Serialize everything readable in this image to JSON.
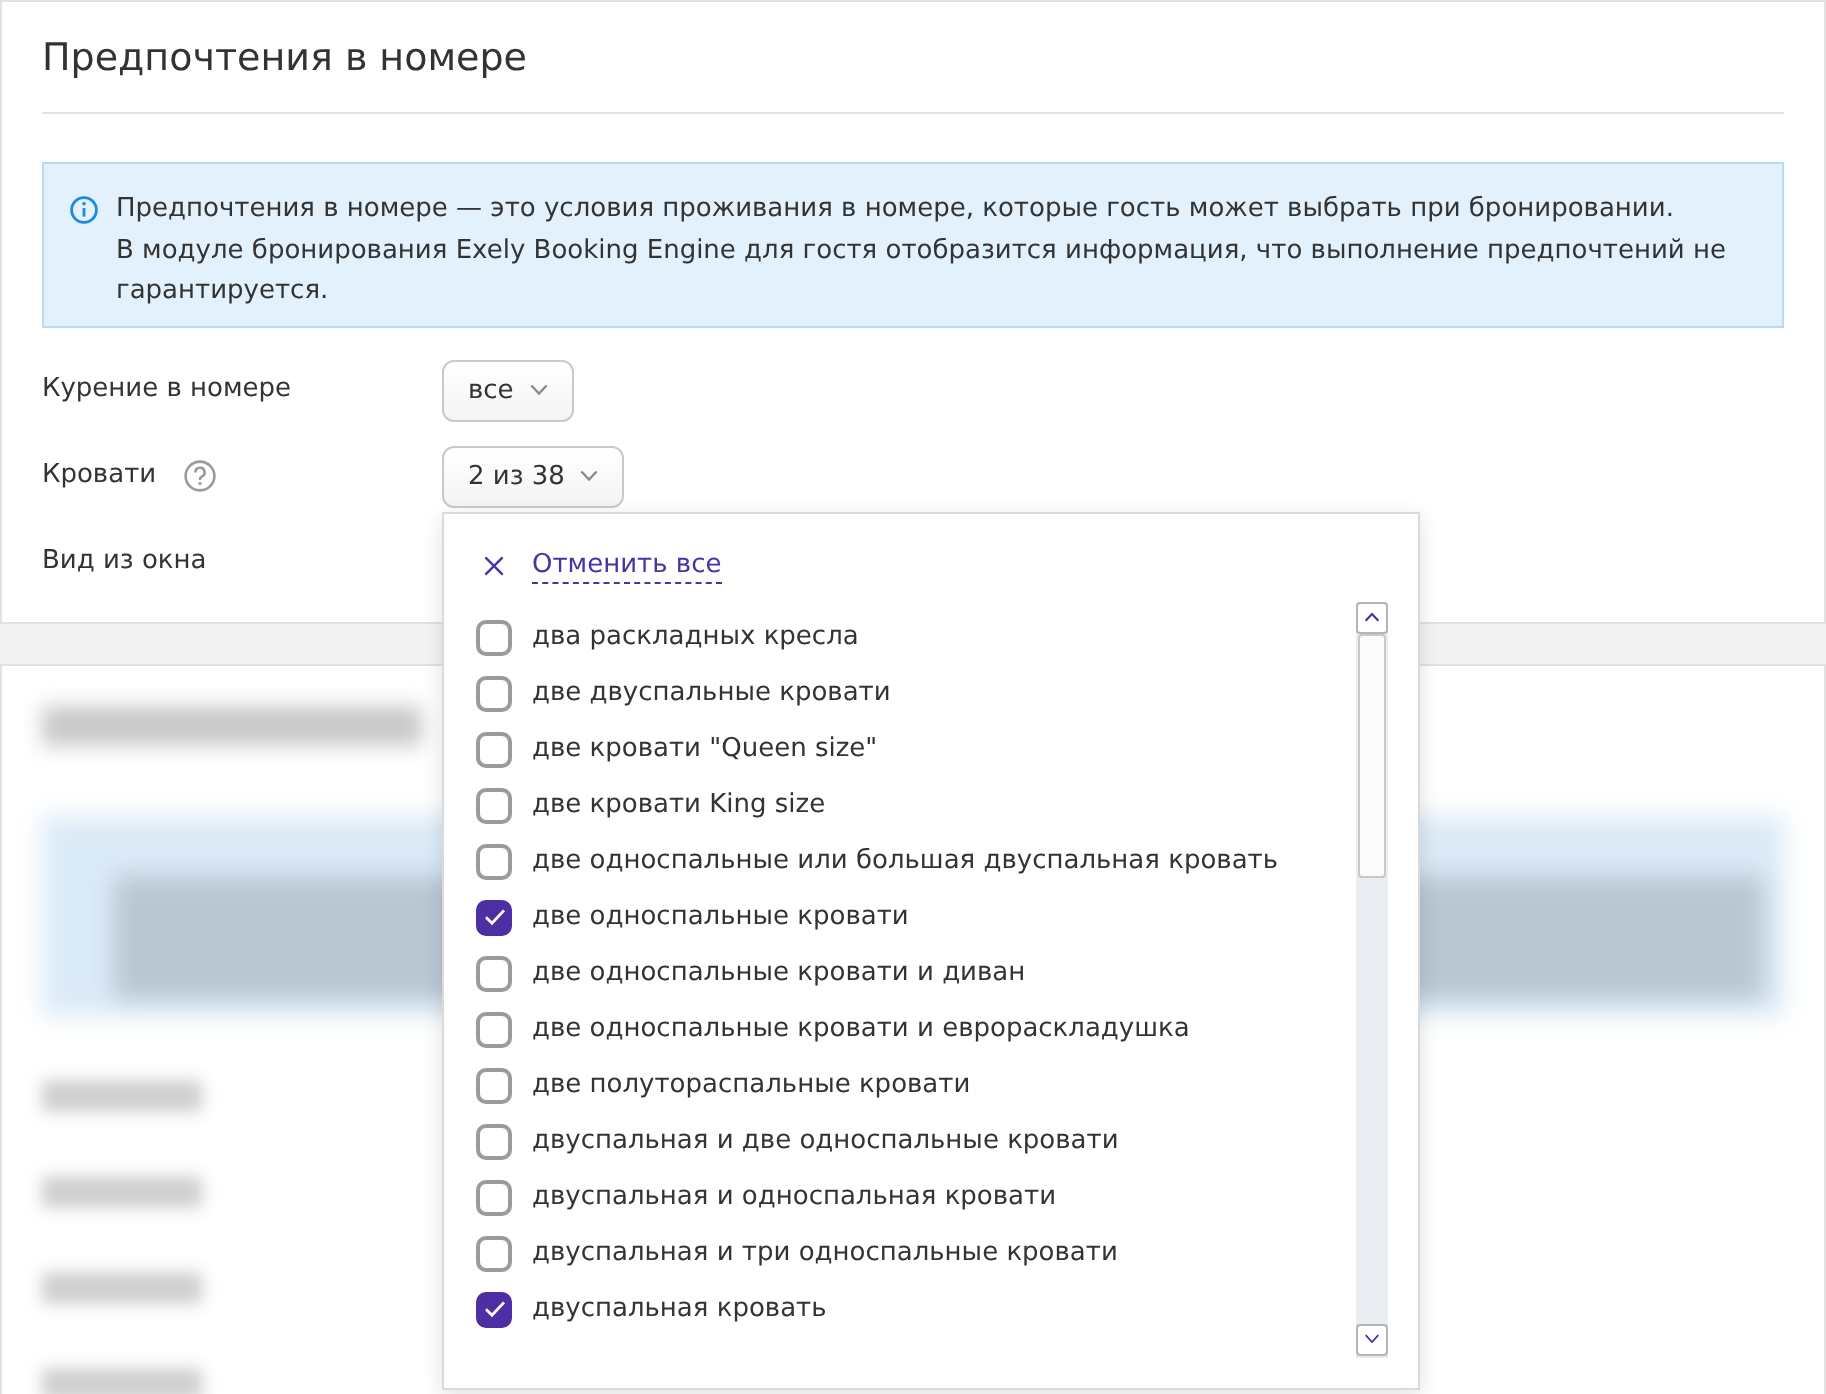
{
  "section": {
    "title": "Предпочтения в номере"
  },
  "notice": {
    "paragraphs": [
      "Предпочтения в номере — это условия проживания в номере, которые гость может выбрать при бронировании.",
      "В модуле бронирования Exely Booking Engine для гостя отобразится информация, что выполнение предпочтений не гарантируется."
    ]
  },
  "fields": [
    {
      "label": "Курение в номере",
      "help": false,
      "value": "все"
    },
    {
      "label": "Кровати",
      "help": true,
      "value": "2 из 38",
      "menu": {
        "clear_label": "Отменить все",
        "options": [
          {
            "label": "два раскладных кресла",
            "checked": false
          },
          {
            "label": "две двуспальные кровати",
            "checked": false
          },
          {
            "label": "две кровати \"Queen size\"",
            "checked": false
          },
          {
            "label": "две кровати King size",
            "checked": false
          },
          {
            "label": "две односпальные или большая двуспальная кровать",
            "checked": false
          },
          {
            "label": "две односпальные кровати",
            "checked": true
          },
          {
            "label": "две односпальные кровати и диван",
            "checked": false
          },
          {
            "label": "две односпальные кровати и еврораскладушка",
            "checked": false
          },
          {
            "label": "две полутораспальные кровати",
            "checked": false
          },
          {
            "label": "двуспальная и две односпальные кровати",
            "checked": false
          },
          {
            "label": "двуспальная и односпальная кровати",
            "checked": false
          },
          {
            "label": "двуспальная и три односпальные кровати",
            "checked": false
          },
          {
            "label": "двуспальная кровать",
            "checked": true
          }
        ]
      }
    },
    {
      "label": "Вид из окна",
      "help": false
    }
  ]
}
